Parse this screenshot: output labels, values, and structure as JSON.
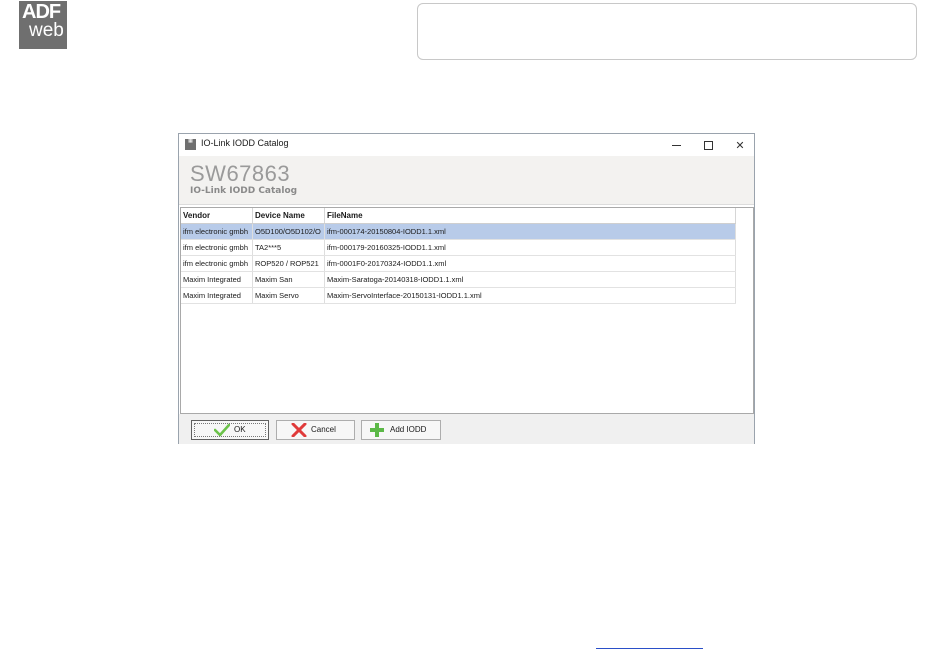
{
  "logo": {
    "line1": "ADF",
    "line2": "web"
  },
  "window": {
    "title": "IO-Link IODD Catalog",
    "controls": {
      "minimize": "minimize",
      "maximize": "maximize",
      "close": "✕"
    }
  },
  "banner": {
    "title": "SW67863",
    "subtitle": "IO-Link IODD Catalog"
  },
  "table": {
    "headers": [
      "Vendor",
      "Device Name",
      "FileName"
    ],
    "rows": [
      [
        "ifm electronic gmbh",
        "O5D100/O5D102/O",
        "ifm-000174-20150804-IODD1.1.xml"
      ],
      [
        "ifm electronic gmbh",
        "TA2***5",
        "ifm-000179-20160325-IODD1.1.xml"
      ],
      [
        "ifm electronic gmbh",
        "ROP520 / ROP521",
        "ifm-0001F0-20170324-IODD1.1.xml"
      ],
      [
        "Maxim Integrated",
        "Maxim San",
        "Maxim-Saratoga-20140318-IODD1.1.xml"
      ],
      [
        "Maxim Integrated",
        "Maxim Servo",
        "Maxim-ServoInterface-20150131-IODD1.1.xml"
      ]
    ],
    "selected_row": 0
  },
  "buttons": {
    "ok": "OK",
    "cancel": "Cancel",
    "add": "Add IODD"
  },
  "colors": {
    "selection": "#b8cbe9",
    "ok_check": "#6cc24a",
    "cancel_x": "#e03a3a",
    "add_plus": "#5cb847"
  }
}
